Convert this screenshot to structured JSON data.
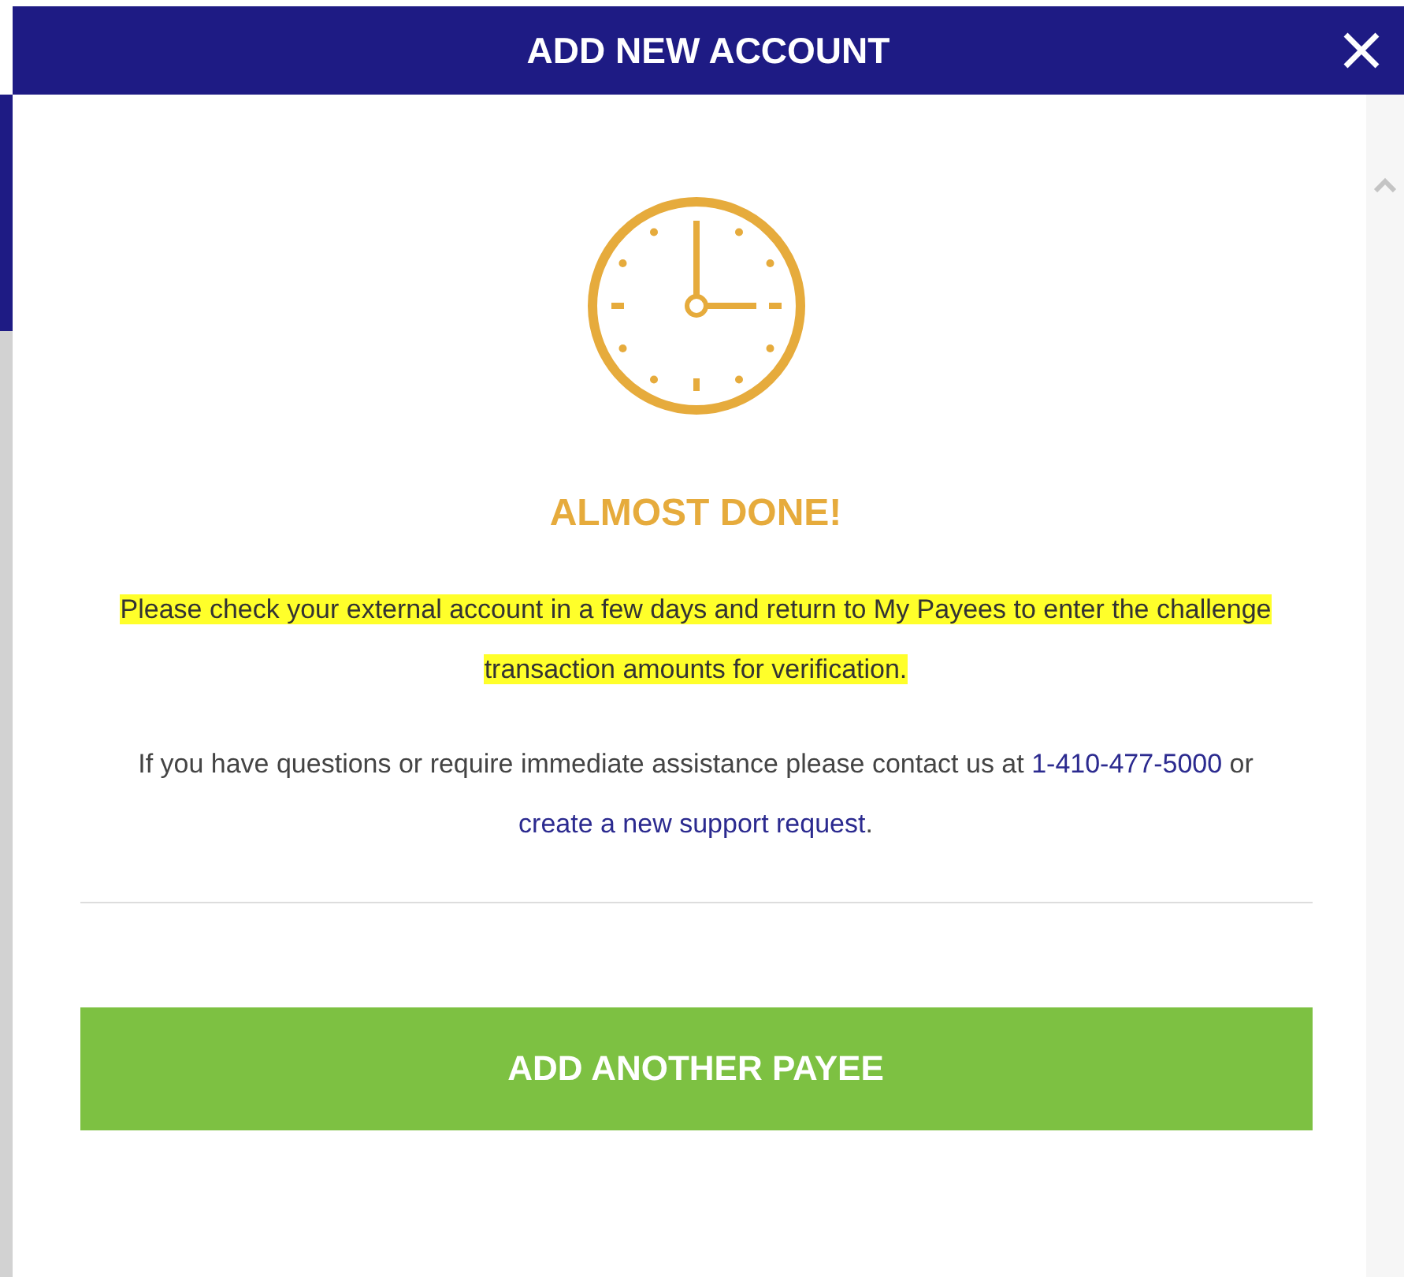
{
  "dialog": {
    "title": "ADD NEW ACCOUNT"
  },
  "status": {
    "heading": "ALMOST DONE!"
  },
  "paragraphs": [
    {
      "text": "Please check your external account in a few days and return to My Payees to enter the challenge transaction amounts for verification.",
      "highlighted": true
    }
  ],
  "help": {
    "parts": [
      {
        "kind": "text",
        "text": "If you have questions or require immediate assistance please contact us at "
      },
      {
        "kind": "link",
        "text": "1-410-477-5000"
      },
      {
        "kind": "text",
        "text": " or "
      },
      {
        "kind": "link",
        "text": "create a new support request"
      },
      {
        "kind": "text",
        "text": "."
      }
    ]
  },
  "buttons": [
    {
      "label": "ADD ANOTHER PAYEE"
    }
  ]
}
